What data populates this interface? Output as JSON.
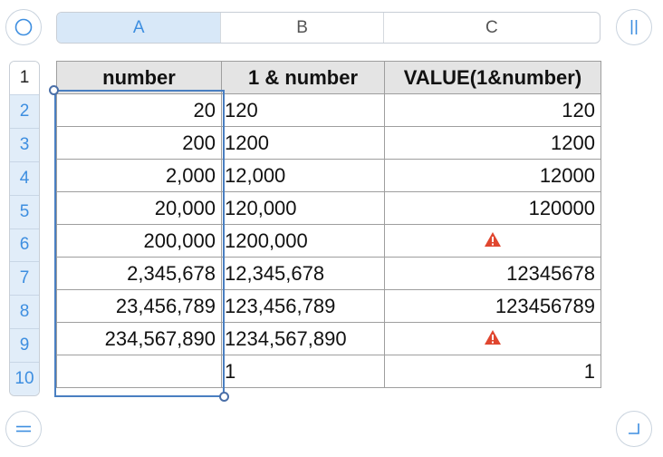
{
  "columns": [
    {
      "label": "A",
      "selected": true,
      "width": 182
    },
    {
      "label": "B",
      "selected": false,
      "width": 180
    },
    {
      "label": "C",
      "selected": false,
      "width": 239
    }
  ],
  "rows": [
    "1",
    "2",
    "3",
    "4",
    "5",
    "6",
    "7",
    "8",
    "9",
    "10"
  ],
  "table": {
    "headers": [
      "number",
      "1 & number",
      "VALUE(1&number)"
    ],
    "cells": [
      [
        "20",
        "120",
        "120"
      ],
      [
        "200",
        "1200",
        "1200"
      ],
      [
        "2,000",
        "12,000",
        "12000"
      ],
      [
        "20,000",
        "120,000",
        "120000"
      ],
      [
        "200,000",
        "1200,000",
        null
      ],
      [
        "2,345,678",
        "12,345,678",
        "12345678"
      ],
      [
        "23,456,789",
        "123,456,789",
        "123456789"
      ],
      [
        "234,567,890",
        "1234,567,890",
        null
      ],
      [
        "",
        "1",
        "1"
      ]
    ]
  },
  "colors": {
    "accent": "#3d8ee0",
    "selection_border": "#4a7fc1",
    "warning": "#e0462f",
    "header_fill": "#e4e4e4"
  },
  "icons": {
    "top_left": "circle-icon",
    "top_right": "pause-bars-icon",
    "bottom_left": "equals-icon",
    "bottom_right": "corner-icon",
    "error": "warning-triangle-icon"
  }
}
